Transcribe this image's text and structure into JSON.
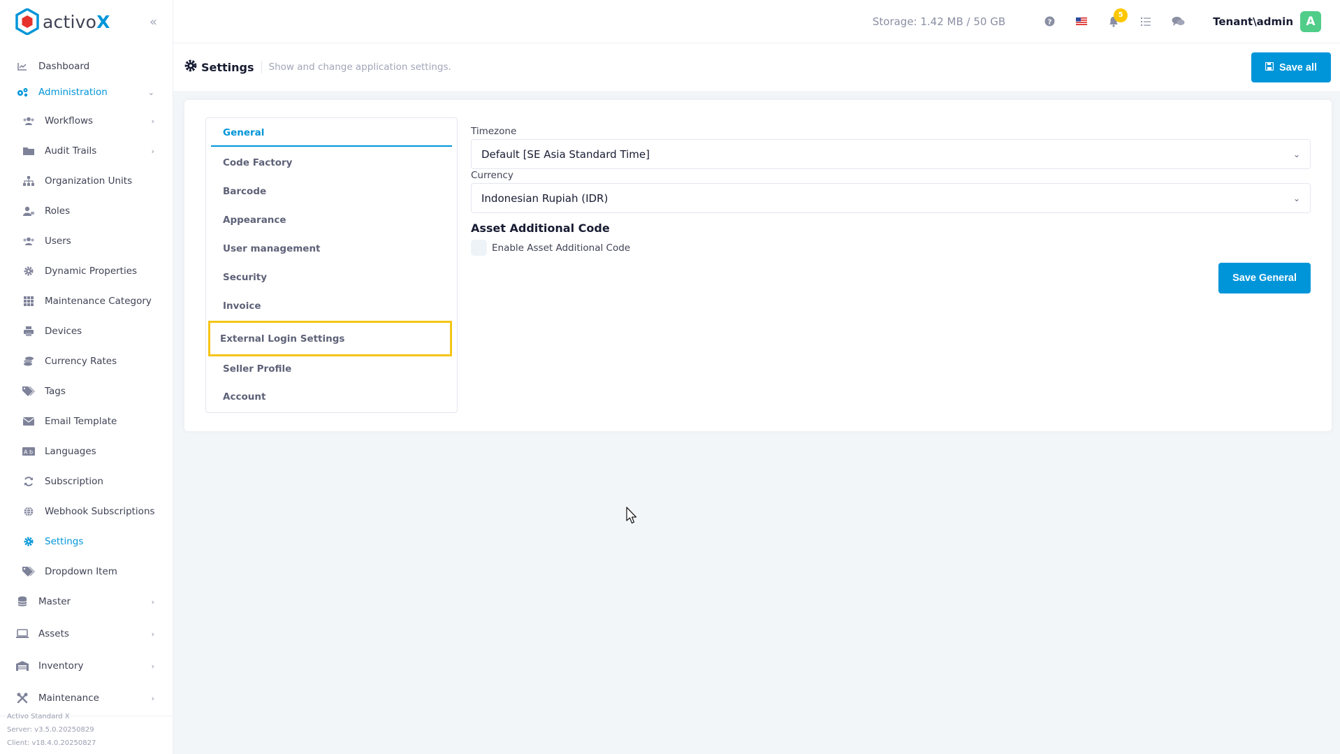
{
  "brand": {
    "name": "activo",
    "name_accent": "X"
  },
  "sidebar": {
    "items": [
      {
        "label": "Dashboard",
        "icon": "chart-line-icon"
      },
      {
        "label": "Administration",
        "icon": "cogs-icon"
      },
      {
        "label": "Workflows",
        "icon": "users-icon"
      },
      {
        "label": "Audit Trails",
        "icon": "folder-icon"
      },
      {
        "label": "Organization Units",
        "icon": "sitemap-icon"
      },
      {
        "label": "Roles",
        "icon": "user-tag-icon"
      },
      {
        "label": "Users",
        "icon": "users-icon"
      },
      {
        "label": "Dynamic Properties",
        "icon": "gear-icon"
      },
      {
        "label": "Maintenance Category",
        "icon": "grid-icon"
      },
      {
        "label": "Devices",
        "icon": "printer-icon"
      },
      {
        "label": "Currency Rates",
        "icon": "coins-icon"
      },
      {
        "label": "Tags",
        "icon": "tags-icon"
      },
      {
        "label": "Email Template",
        "icon": "envelope-icon"
      },
      {
        "label": "Languages",
        "icon": "language-icon"
      },
      {
        "label": "Subscription",
        "icon": "refresh-icon"
      },
      {
        "label": "Webhook Subscriptions",
        "icon": "globe-icon"
      },
      {
        "label": "Settings",
        "icon": "gear-icon"
      },
      {
        "label": "Dropdown Item",
        "icon": "tags-icon"
      },
      {
        "label": "Master",
        "icon": "database-icon"
      },
      {
        "label": "Assets",
        "icon": "laptop-icon"
      },
      {
        "label": "Inventory",
        "icon": "warehouse-icon"
      },
      {
        "label": "Maintenance",
        "icon": "tools-icon"
      }
    ],
    "footer": {
      "product": "Activo Standard X",
      "server": "Server: v3.5.0.20250829",
      "client": "Client: v18.4.0.20250827"
    }
  },
  "header": {
    "storage": "Storage: 1.42 MB / 50 GB",
    "notification_count": "5",
    "user": "Tenant\\admin",
    "avatar_letter": "A"
  },
  "subheader": {
    "title": "Settings",
    "description": "Show and change application settings.",
    "save_all_label": "Save all"
  },
  "settings": {
    "tabs": [
      "General",
      "Code Factory",
      "Barcode",
      "Appearance",
      "User management",
      "Security",
      "Invoice",
      "External Login Settings",
      "Seller Profile",
      "Account"
    ],
    "timezone_label": "Timezone",
    "timezone_value": "Default [SE Asia Standard Time]",
    "currency_label": "Currency",
    "currency_value": "Indonesian Rupiah (IDR)",
    "asset_code_title": "Asset Additional Code",
    "asset_code_checkbox_label": "Enable Asset Additional Code",
    "save_general_label": "Save General"
  },
  "colors": {
    "primary": "#0095d9",
    "highlight": "#f5c518",
    "avatar": "#50cd89",
    "badge": "#ffc700"
  }
}
